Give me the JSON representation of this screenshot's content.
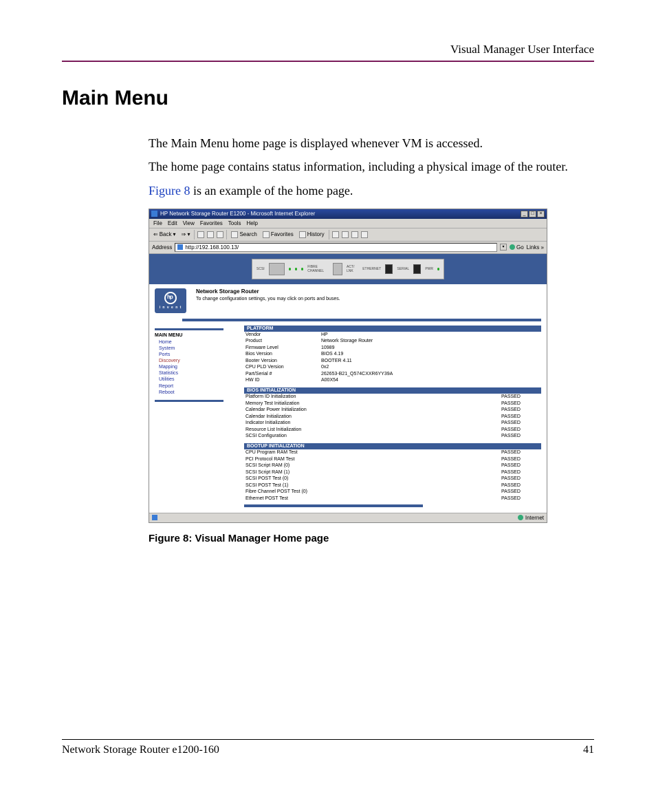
{
  "doc": {
    "header": "Visual Manager User Interface",
    "title": "Main Menu",
    "p1": "The Main Menu home page is displayed whenever VM is accessed.",
    "p2": "The home page contains status information, including a physical image of the router.",
    "p3a": "Figure 8",
    "p3b": " is an example of the home page.",
    "fig_caption": "Figure 8:  Visual Manager Home page",
    "footer_left": "Network Storage Router e1200-160",
    "footer_right": "41"
  },
  "browser": {
    "title": "HP Network Storage Router E1200 - Microsoft Internet Explorer",
    "menus": {
      "file": "File",
      "edit": "Edit",
      "view": "View",
      "favorites": "Favorites",
      "tools": "Tools",
      "help": "Help"
    },
    "toolbar": {
      "back": "Back",
      "search": "Search",
      "favorites": "Favorites",
      "history": "History"
    },
    "address_label": "Address",
    "address_value": "http://192.168.100.13/",
    "go": "Go",
    "links": "Links »",
    "status_right": "Internet"
  },
  "device": {
    "labels": {
      "scsi": "SCSI",
      "fibre": "FIBRE CHANNEL",
      "act": "ACT/ LNK",
      "eth": "ETHERNET",
      "serial": "SERIAL",
      "pwr": "PWR"
    }
  },
  "hp": {
    "brand_sub": "i n v e n t",
    "title": "Network Storage Router",
    "subtitle": "To change configuration settings, you may click on ports and buses."
  },
  "menu": {
    "head": "MAIN MENU",
    "items": [
      "Home",
      "System",
      "Ports",
      "Discovery",
      "Mapping",
      "Statistics",
      "Utilities",
      "Report",
      "Reboot"
    ]
  },
  "platform": {
    "head": "PLATFORM",
    "rows": [
      {
        "k": "Vendor",
        "v": "HP"
      },
      {
        "k": "Product",
        "v": "Network Storage Router"
      },
      {
        "k": "Firmware Level",
        "v": "10989"
      },
      {
        "k": "Bios Version",
        "v": "BIOS 4.19"
      },
      {
        "k": "Booter Version",
        "v": "BOOTER 4.11"
      },
      {
        "k": "CPU PLD Version",
        "v": "0x2"
      },
      {
        "k": "Part/Serial #",
        "v": "262653-B21_Q574CXXR6YY39A"
      },
      {
        "k": "HW ID",
        "v": "A00X54"
      }
    ]
  },
  "bios": {
    "head": "BIOS INITIALIZATION",
    "rows": [
      {
        "k": "Platform ID Initialization",
        "v": "PASSED"
      },
      {
        "k": "Memory Test Initialization",
        "v": "PASSED"
      },
      {
        "k": "Calendar Power Initialization",
        "v": "PASSED"
      },
      {
        "k": "Calendar Initialization",
        "v": "PASSED"
      },
      {
        "k": "Indicator Initialization",
        "v": "PASSED"
      },
      {
        "k": "Resource List Initialization",
        "v": "PASSED"
      },
      {
        "k": "SCSI Configuration",
        "v": "PASSED"
      }
    ]
  },
  "boot": {
    "head": "BOOTUP INITIALIZATION",
    "rows": [
      {
        "k": "CPU Program RAM Test",
        "v": "PASSED"
      },
      {
        "k": "PCI Protocol RAM Test",
        "v": "PASSED"
      },
      {
        "k": "SCSI Script RAM (0)",
        "v": "PASSED"
      },
      {
        "k": "SCSI Script RAM (1)",
        "v": "PASSED"
      },
      {
        "k": "SCSI POST Test (0)",
        "v": "PASSED"
      },
      {
        "k": "SCSI POST Test (1)",
        "v": "PASSED"
      },
      {
        "k": "Fibre Channel POST Test (0)",
        "v": "PASSED"
      },
      {
        "k": "Ethernet POST Test",
        "v": "PASSED"
      }
    ]
  }
}
